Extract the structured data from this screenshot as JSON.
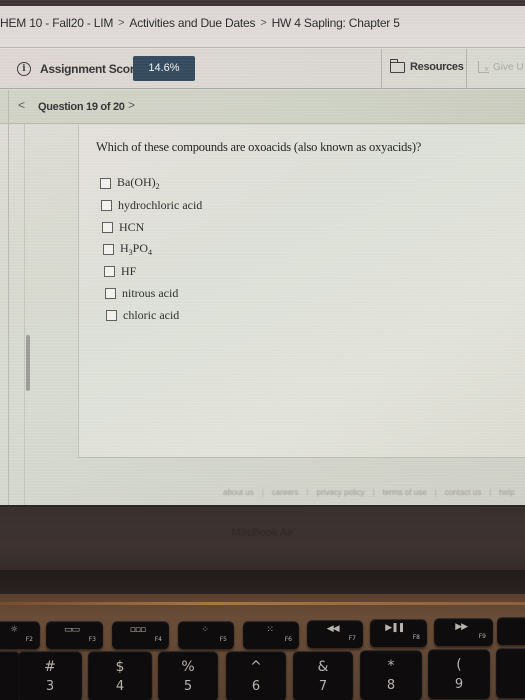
{
  "breadcrumb": {
    "items": [
      "HEM 10 - Fall20 - LIM",
      "Activities and Due Dates",
      "HW 4 Sapling: Chapter 5"
    ],
    "separator": ">"
  },
  "score_bar": {
    "info_icon": "info-icon",
    "label": "Assignment Score:",
    "score": "14.6%",
    "score_badge_color": "#33485d",
    "resources_label": "Resources",
    "give_up_label": "Give U"
  },
  "question_nav": {
    "prev": "<",
    "label": "Question 19 of 20",
    "next": ">"
  },
  "question": {
    "prompt": "Which of these compounds are oxoacids (also known as oxyacids)?",
    "choices": [
      {
        "label_parts": [
          "Ba(OH)",
          "2",
          ""
        ],
        "checked": false
      },
      {
        "label_parts": [
          "hydrochloric acid"
        ],
        "checked": false
      },
      {
        "label_parts": [
          "HCN"
        ],
        "checked": false
      },
      {
        "label_parts": [
          "H",
          "3",
          "PO",
          "4"
        ],
        "checked": false
      },
      {
        "label_parts": [
          "HF"
        ],
        "checked": false
      },
      {
        "label_parts": [
          "nitrous acid"
        ],
        "checked": false
      },
      {
        "label_parts": [
          "chloric acid"
        ],
        "checked": false
      }
    ]
  },
  "footer": {
    "links": [
      "about us",
      "careers",
      "privacy policy",
      "terms of use",
      "contact us",
      "help"
    ]
  },
  "laptop": {
    "bezel_label": "MacBook Air",
    "function_keys": [
      {
        "glyph": "☼",
        "label": "F2"
      },
      {
        "glyph": "▭▭",
        "label": "F3"
      },
      {
        "glyph": "▫▫▫",
        "label": "F4"
      },
      {
        "glyph": "⁘",
        "label": "F5"
      },
      {
        "glyph": "⁙",
        "label": "F6"
      },
      {
        "glyph": "◀◀",
        "label": "F7"
      },
      {
        "glyph": "▶❚❚",
        "label": "F8"
      },
      {
        "glyph": "▶▶",
        "label": "F9"
      }
    ],
    "number_keys": [
      {
        "top": "#",
        "bottom": "3"
      },
      {
        "top": "$",
        "bottom": "4"
      },
      {
        "top": "%",
        "bottom": "5"
      },
      {
        "top": "^",
        "bottom": "6"
      },
      {
        "top": "&",
        "bottom": "7"
      },
      {
        "top": "*",
        "bottom": "8"
      },
      {
        "top": "(",
        "bottom": "9"
      }
    ]
  }
}
